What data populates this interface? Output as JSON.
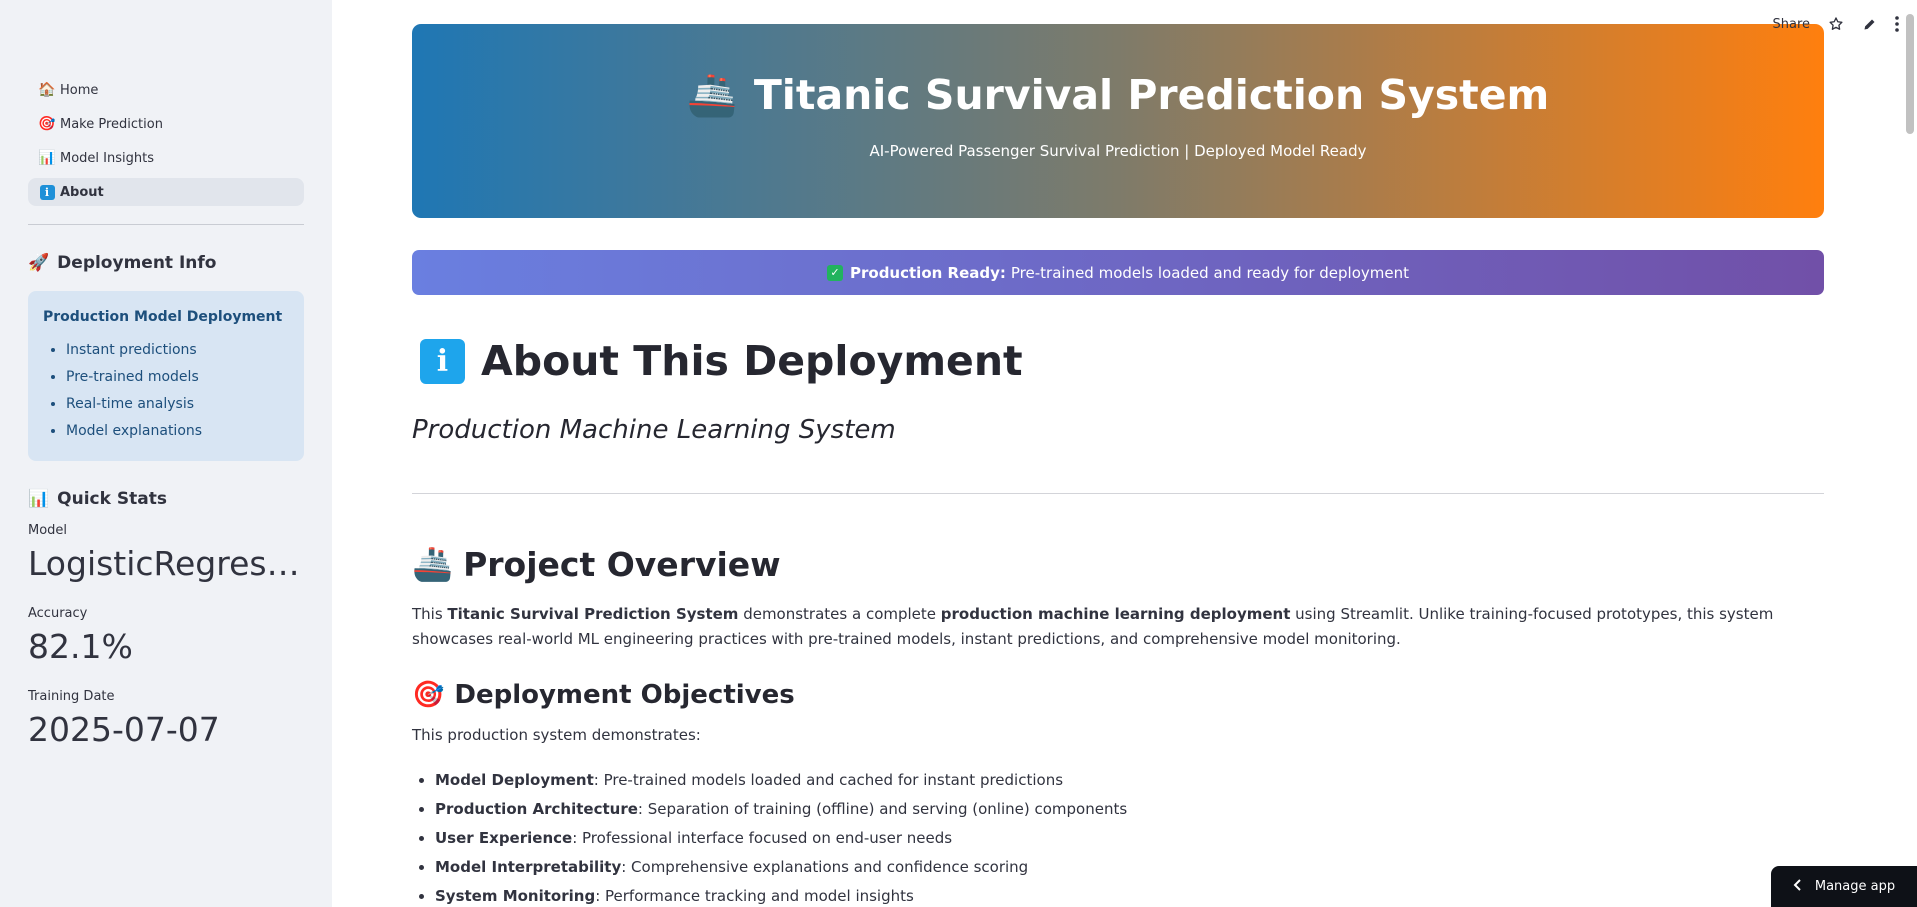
{
  "sidebar": {
    "nav": [
      {
        "label": "Home",
        "icon": "🏠"
      },
      {
        "label": "Make Prediction",
        "icon": "🎯"
      },
      {
        "label": "Model Insights",
        "icon": "📊"
      },
      {
        "label": "About",
        "icon": "i"
      }
    ],
    "deployment_info": {
      "heading": "Deployment Info",
      "icon": "🚀",
      "box_title": "Production Model Deployment",
      "items": [
        "Instant predictions",
        "Pre-trained models",
        "Real-time analysis",
        "Model explanations"
      ]
    },
    "quick_stats": {
      "heading": "Quick Stats",
      "icon": "📊",
      "metrics": [
        {
          "label": "Model",
          "value": "LogisticRegression"
        },
        {
          "label": "Accuracy",
          "value": "82.1%"
        },
        {
          "label": "Training Date",
          "value": "2025-07-07"
        }
      ]
    }
  },
  "toolbar": {
    "share_label": "Share"
  },
  "hero": {
    "icon": "🚢",
    "title": "Titanic Survival Prediction System",
    "subtitle": "AI-Powered Passenger Survival Prediction | Deployed Model Ready"
  },
  "banner": {
    "bold": "Production Ready:",
    "text": "Pre-trained models loaded and ready for deployment"
  },
  "page": {
    "title_icon": "i",
    "title": "About This Deployment",
    "subtitle": "Production Machine Learning System"
  },
  "overview": {
    "icon": "🚢",
    "heading": "Project Overview",
    "p1_a": "This ",
    "p1_b": "Titanic Survival Prediction System",
    "p1_c": " demonstrates a complete ",
    "p1_d": "production machine learning deployment",
    "p1_e": " using Streamlit. Unlike training-focused prototypes, this system showcases real-world ML engineering practices with pre-trained models, instant predictions, and comprehensive model monitoring."
  },
  "objectives": {
    "icon": "🎯",
    "heading": "Deployment Objectives",
    "intro": "This production system demonstrates:",
    "items": [
      {
        "bold": "Model Deployment",
        "text": ": Pre-trained models loaded and cached for instant predictions"
      },
      {
        "bold": "Production Architecture",
        "text": ": Separation of training (offline) and serving (online) components"
      },
      {
        "bold": "User Experience",
        "text": ": Professional interface focused on end-user needs"
      },
      {
        "bold": "Model Interpretability",
        "text": ": Comprehensive explanations and confidence scoring"
      },
      {
        "bold": "System Monitoring",
        "text": ": Performance tracking and model insights"
      }
    ]
  },
  "manage_app": {
    "label": "Manage app"
  }
}
